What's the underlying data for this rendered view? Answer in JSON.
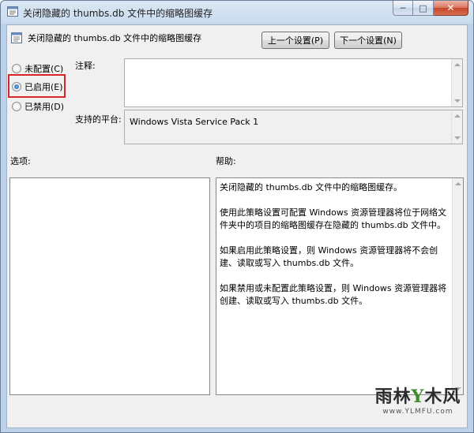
{
  "window": {
    "title": "关闭隐藏的 thumbs.db 文件中的缩略图缓存",
    "minimize_glyph": "─",
    "maximize_glyph": "□",
    "close_glyph": "✕"
  },
  "policy": {
    "name": "关闭隐藏的 thumbs.db 文件中的缩略图缓存"
  },
  "nav": {
    "prev_label": "上一个设置(P)",
    "next_label": "下一个设置(N)"
  },
  "state": {
    "options": [
      {
        "label": "未配置(C)",
        "checked": false
      },
      {
        "label": "已启用(E)",
        "checked": true
      },
      {
        "label": "已禁用(D)",
        "checked": false
      }
    ]
  },
  "labels": {
    "comment": "注释:",
    "platform": "支持的平台:",
    "options": "选项:",
    "help": "帮助:"
  },
  "fields": {
    "comment_value": "",
    "platform_value": "Windows Vista Service Pack 1"
  },
  "help_text": [
    "关闭隐藏的 thumbs.db 文件中的缩略图缓存。",
    "使用此策略设置可配置 Windows 资源管理器将位于网络文件夹中的项目的缩略图缓存在隐藏的 thumbs.db 文件中。",
    "如果启用此策略设置，则 Windows 资源管理器将不会创建、读取或写入 thumbs.db 文件。",
    "如果禁用或未配置此策略设置，则 Windows 资源管理器将创建、读取或写入 thumbs.db 文件。"
  ],
  "watermark": {
    "brand_left": "雨林",
    "brand_y": "Y",
    "brand_right": "木风",
    "url": "www.YLMFU.com"
  },
  "colors": {
    "highlight": "#d9242a",
    "radio_dot": "#1d5fa8"
  }
}
